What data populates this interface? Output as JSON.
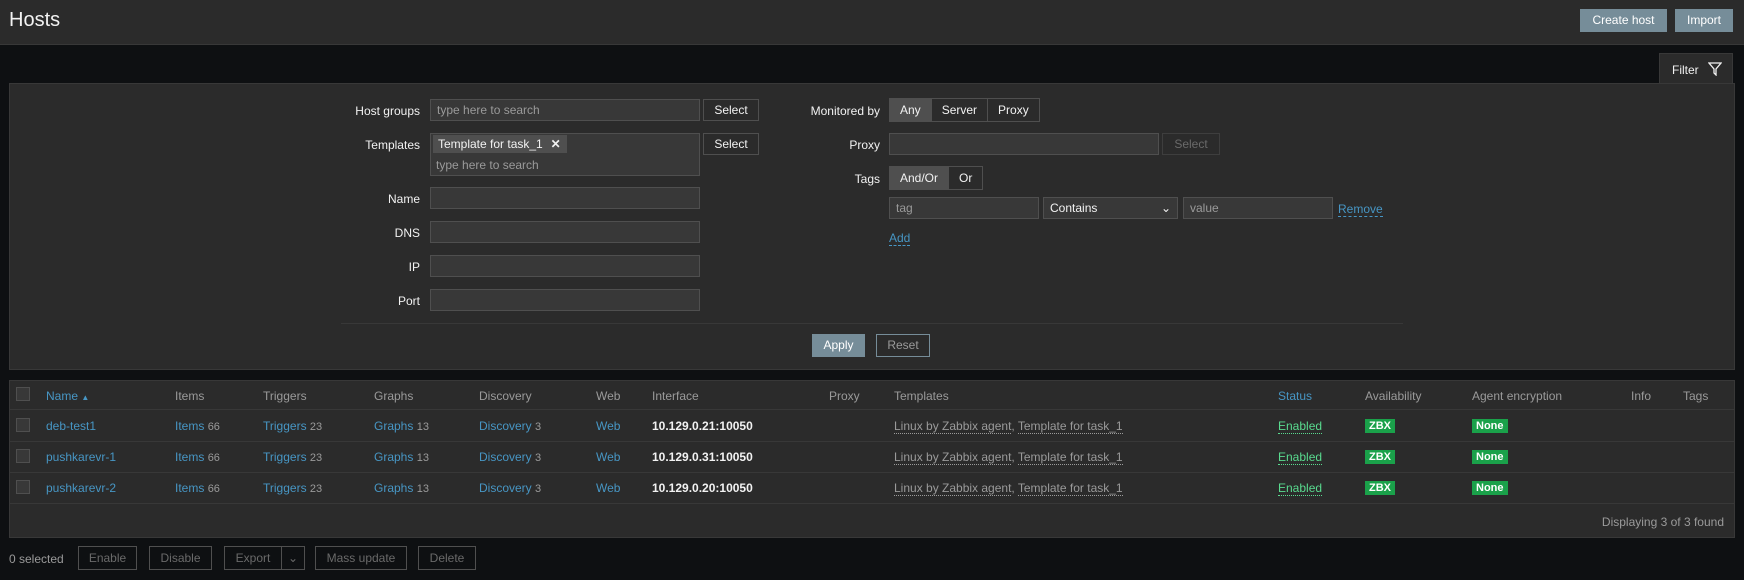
{
  "header": {
    "title": "Hosts",
    "create_host": "Create host",
    "import": "Import"
  },
  "filter": {
    "tab_label": "Filter",
    "host_groups_label": "Host groups",
    "host_groups_placeholder": "type here to search",
    "templates_label": "Templates",
    "templates_chip": "Template for task_1",
    "templates_placeholder": "type here to search",
    "select_label": "Select",
    "name_label": "Name",
    "dns_label": "DNS",
    "ip_label": "IP",
    "port_label": "Port",
    "monitored_by_label": "Monitored by",
    "monitored_by_options": [
      "Any",
      "Server",
      "Proxy"
    ],
    "proxy_label": "Proxy",
    "tags_label": "Tags",
    "tags_options": [
      "And/Or",
      "Or"
    ],
    "tag_placeholder": "tag",
    "tag_operator": "Contains",
    "value_placeholder": "value",
    "remove_label": "Remove",
    "add_label": "Add",
    "apply_label": "Apply",
    "reset_label": "Reset"
  },
  "table": {
    "columns": {
      "name": "Name",
      "items": "Items",
      "triggers": "Triggers",
      "graphs": "Graphs",
      "discovery": "Discovery",
      "web": "Web",
      "interface": "Interface",
      "proxy": "Proxy",
      "templates": "Templates",
      "status": "Status",
      "availability": "Availability",
      "agent_encryption": "Agent encryption",
      "info": "Info",
      "tags": "Tags"
    },
    "rows": [
      {
        "name": "deb-test1",
        "items": "Items",
        "items_count": "66",
        "triggers": "Triggers",
        "triggers_count": "23",
        "graphs": "Graphs",
        "graphs_count": "13",
        "discovery": "Discovery",
        "discovery_count": "3",
        "web": "Web",
        "interface": "10.129.0.21:10050",
        "template1": "Linux by Zabbix agent",
        "template2": "Template for task_1",
        "status": "Enabled",
        "availability": "ZBX",
        "encryption": "None"
      },
      {
        "name": "pushkarevr-1",
        "items": "Items",
        "items_count": "66",
        "triggers": "Triggers",
        "triggers_count": "23",
        "graphs": "Graphs",
        "graphs_count": "13",
        "discovery": "Discovery",
        "discovery_count": "3",
        "web": "Web",
        "interface": "10.129.0.31:10050",
        "template1": "Linux by Zabbix agent",
        "template2": "Template for task_1",
        "status": "Enabled",
        "availability": "ZBX",
        "encryption": "None"
      },
      {
        "name": "pushkarevr-2",
        "items": "Items",
        "items_count": "66",
        "triggers": "Triggers",
        "triggers_count": "23",
        "graphs": "Graphs",
        "graphs_count": "13",
        "discovery": "Discovery",
        "discovery_count": "3",
        "web": "Web",
        "interface": "10.129.0.20:10050",
        "template1": "Linux by Zabbix agent",
        "template2": "Template for task_1",
        "status": "Enabled",
        "availability": "ZBX",
        "encryption": "None"
      }
    ],
    "footer": "Displaying 3 of 3 found"
  },
  "bottom": {
    "selected": "0 selected",
    "enable": "Enable",
    "disable": "Disable",
    "export": "Export",
    "mass_update": "Mass update",
    "delete": "Delete"
  },
  "colors": {
    "accent": "#768d99",
    "link": "#4796c4",
    "enabled": "#59db8f",
    "badge": "#1aa14a"
  }
}
